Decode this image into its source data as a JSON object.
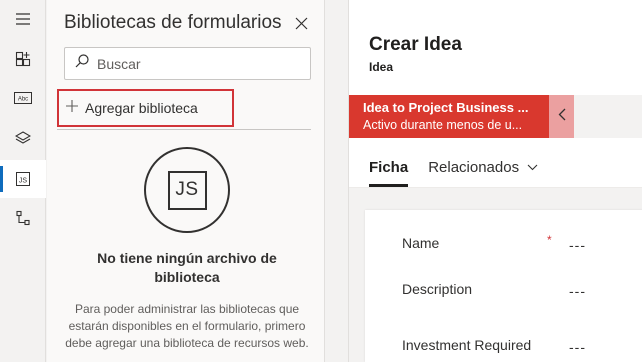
{
  "rail": {
    "items": [
      {
        "name": "menu-icon"
      },
      {
        "name": "components-icon"
      },
      {
        "name": "text-field-icon"
      },
      {
        "name": "layers-icon"
      },
      {
        "name": "js-library-icon"
      },
      {
        "name": "tree-view-icon"
      }
    ],
    "active_index": 4
  },
  "panel": {
    "title": "Bibliotecas de formularios",
    "search_placeholder": "Buscar",
    "add_label": "Agregar biblioteca",
    "empty_icon_text": "JS",
    "empty_title": "No tiene ningún archivo de biblioteca",
    "empty_description": "Para poder administrar las bibliotecas que estarán disponibles en el formulario, primero debe agregar una biblioteca de recursos web."
  },
  "form": {
    "title": "Crear Idea",
    "subtitle": "Idea",
    "bpf": {
      "stage_name": "Idea to Project Business ...",
      "stage_status": "Activo durante menos de u..."
    },
    "tabs": [
      {
        "label": "Ficha",
        "active": true
      },
      {
        "label": "Relacionados",
        "active": false
      }
    ],
    "fields": [
      {
        "label": "Name",
        "required": true,
        "required_marker": "*",
        "value": "---"
      },
      {
        "label": "Description",
        "required": false,
        "value": "---"
      },
      {
        "label": "Investment Required",
        "required": false,
        "value": "---"
      }
    ]
  },
  "colors": {
    "accent": "#0f6cbd",
    "highlight_border": "#d13438",
    "bpf_stage": "#d9382e",
    "bpf_arrow": "#eba0a0"
  }
}
